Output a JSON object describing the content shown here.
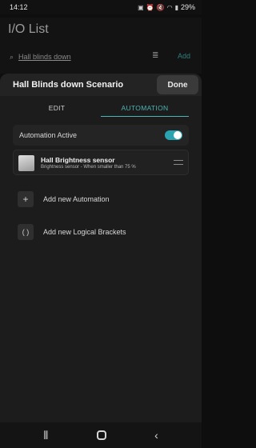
{
  "status": {
    "time": "14:12",
    "battery": "29%"
  },
  "background": {
    "title": "I/O List",
    "search_value": "Hall blinds down",
    "add_label": "Add"
  },
  "sheet": {
    "title": "Hall Blinds down Scenario",
    "done_label": "Done",
    "tabs": [
      {
        "label": "EDIT"
      },
      {
        "label": "AUTOMATION"
      }
    ],
    "automation_active": {
      "label": "Automation Active",
      "enabled": true
    },
    "sensor": {
      "name": "Hall Brightness sensor",
      "description": "Brightness sensor - When smaller than 75 %"
    },
    "actions": [
      {
        "label": "Add new Automation",
        "icon": "plus-icon"
      },
      {
        "label": "Add new Logical Brackets",
        "icon": "brackets-icon"
      }
    ]
  },
  "colors": {
    "accent": "#4fb3b3",
    "toggle": "#2aa4b0"
  }
}
